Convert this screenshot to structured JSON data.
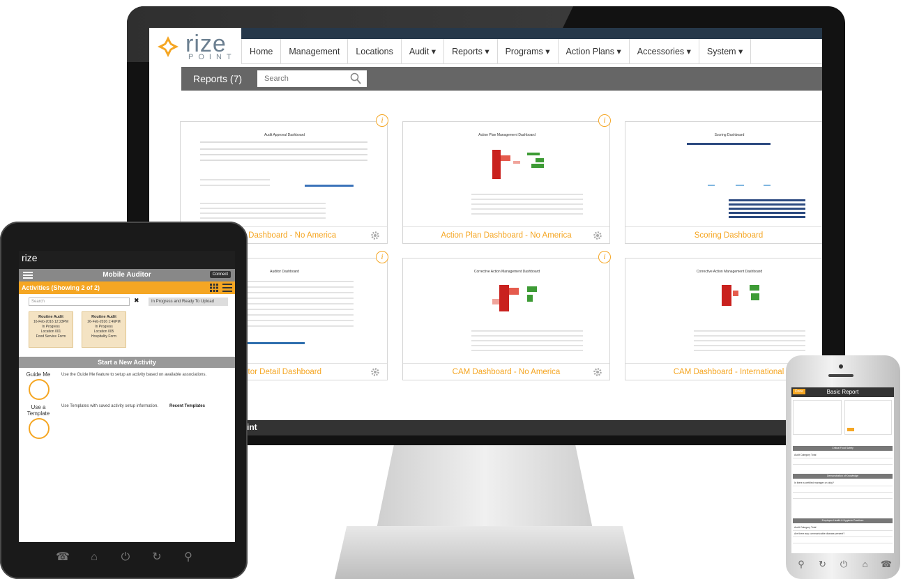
{
  "brand": {
    "word": "rize",
    "sub": "POINT",
    "footer": "int"
  },
  "nav": [
    "Home",
    "Management",
    "Locations",
    "Audit ▾",
    "Reports ▾",
    "Programs ▾",
    "Action Plans ▾",
    "Accessories ▾",
    "System ▾"
  ],
  "toolbar": {
    "title": "Reports (7)",
    "search_placeholder": "Search"
  },
  "cards": [
    {
      "title": "Audit Approval Dashboard - No America",
      "visible_title": "oval Dashboard - No America",
      "thumb_title": "Audit Approval Dashboard"
    },
    {
      "title": "Action Plan Dashboard - No America",
      "visible_title": "Action Plan Dashboard - No America",
      "thumb_title": "Action Plan Management Dashboard"
    },
    {
      "title": "Scoring Dashboard",
      "visible_title": "Scoring Dashboard",
      "thumb_title": "Scoring Dashboard"
    },
    {
      "title": "Auditor Detail Dashboard",
      "visible_title": "itor Detail Dashboard",
      "thumb_title": "Auditor Dashboard"
    },
    {
      "title": "CAM Dashboard - No America",
      "visible_title": "CAM Dashboard - No America",
      "thumb_title": "Corrective Action Management Dashboard"
    },
    {
      "title": "CAM Dashboard - International",
      "visible_title": "CAM Dashboard - International",
      "thumb_title": "Corrective Action Management Dashboard"
    }
  ],
  "tablet": {
    "brand": "rize",
    "title": "Mobile Auditor",
    "connect": "Connect",
    "activities": "Activities (Showing 2 of 2)",
    "search_placeholder": "Search",
    "filter": "In Progress and Ready To Upload",
    "tiles": [
      {
        "name": "Routine Audit",
        "date": "16-Feb-2016 12:23PM",
        "status": "In Progress",
        "location": "Location 001",
        "form": "Food Service Form"
      },
      {
        "name": "Routine Audit",
        "date": "26-Feb-2016 1:46PM",
        "status": "In Progress",
        "location": "Location 005",
        "form": "Hospitality Form"
      }
    ],
    "start": "Start a New Activity",
    "guide_label": "Guide Me",
    "guide_desc": "Use the Guide Me feature to setup an activity based on available associations.",
    "template_label": "Use a Template",
    "template_desc": "Use Templates with saved activity setup information.",
    "recent": "Recent Templates"
  },
  "phone": {
    "done": "Done",
    "title": "Basic Report",
    "sections": [
      "Critical Food Safety",
      "Demonstration of Knowledge",
      "Employee Health & Hygienic Practices"
    ],
    "rows": [
      "Audit Category Total",
      "Is there a certified manager on duty?",
      "Audit Category Total",
      "Are there any communicable disease present?"
    ]
  },
  "colors": {
    "accent": "#f5a623",
    "nav_dark": "#26384a",
    "toolbar": "#666666"
  }
}
